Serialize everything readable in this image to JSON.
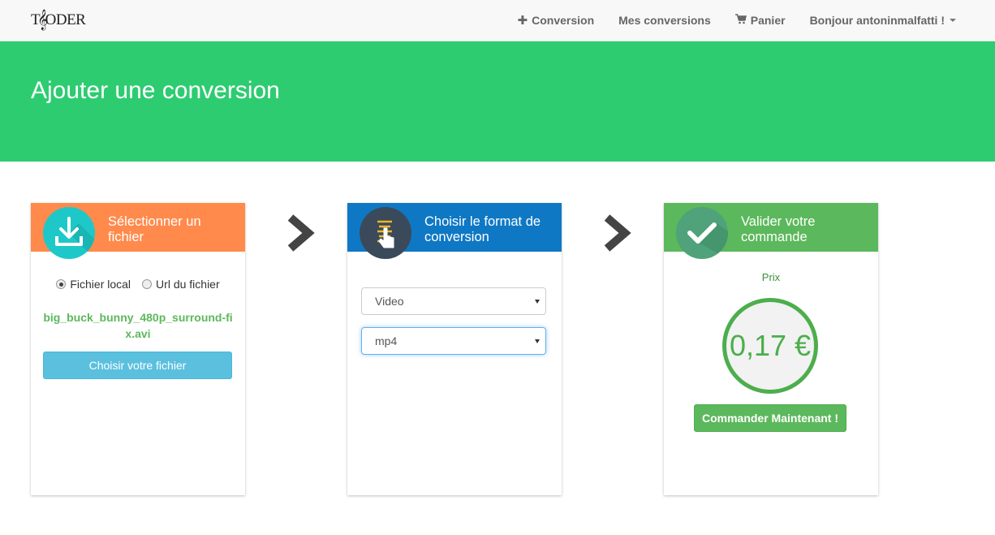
{
  "navbar": {
    "brand_prefix": "T",
    "brand_suffix": "ODER",
    "links": {
      "conversion": "Conversion",
      "mes_conversions": "Mes conversions",
      "panier": "Panier",
      "user": "Bonjour antoninmalfatti !"
    }
  },
  "banner": {
    "title": "Ajouter une conversion"
  },
  "steps": {
    "select_file": {
      "title": "Sélectionner un fichier",
      "radio_local": "Fichier local",
      "radio_url": "Url du fichier",
      "selected_radio": "Fichier local",
      "filename": "big_buck_bunny_480p_surround-fix.avi",
      "button": "Choisir votre fichier"
    },
    "choose_format": {
      "title": "Choisir le format de conversion",
      "type_value": "Video",
      "format_value": "mp4"
    },
    "validate": {
      "title": "Valider votre commande",
      "price_label": "Prix",
      "price_value": "0,17 €",
      "button": "Commander Maintenant !"
    }
  },
  "colors": {
    "banner": "#2ecc71",
    "step1_header": "#ff8a4c",
    "step2_header": "#0f78c4",
    "step3_header": "#5cb85c",
    "accent_green": "#5cb85c",
    "info_button": "#5bc0de"
  }
}
